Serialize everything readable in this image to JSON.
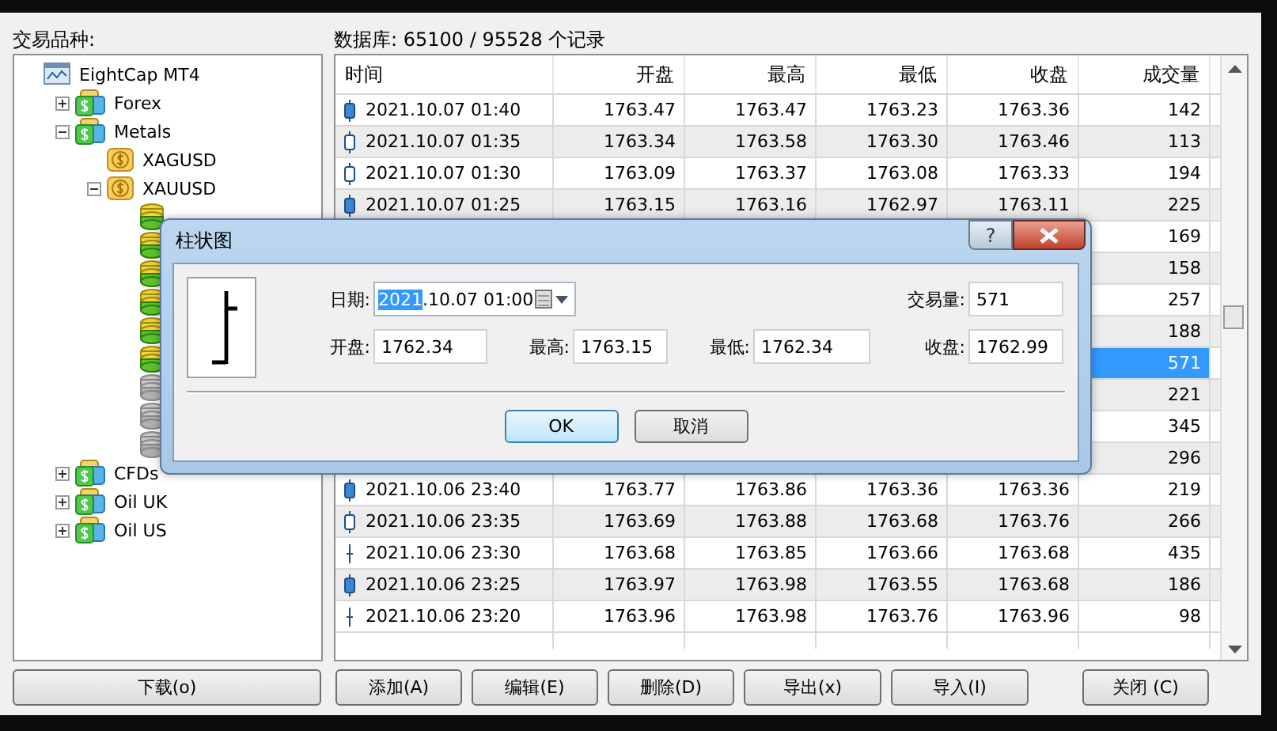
{
  "symbols_label": "交易品种:",
  "tree": [
    {
      "label": "EightCap MT4",
      "kind": "server",
      "children": [
        {
          "label": "Forex",
          "kind": "group",
          "expanded": false
        },
        {
          "label": "Metals",
          "kind": "group",
          "expanded": true,
          "children": [
            {
              "label": "XAGUSD",
              "kind": "symbol"
            },
            {
              "label": "XAUUSD",
              "kind": "symbol",
              "expanded": true,
              "children": [
                {
                  "kind": "period",
                  "available": true
                },
                {
                  "kind": "period",
                  "available": true
                },
                {
                  "kind": "period",
                  "available": true
                },
                {
                  "kind": "period",
                  "available": true
                },
                {
                  "kind": "period",
                  "available": true
                },
                {
                  "kind": "period",
                  "available": true
                },
                {
                  "kind": "period",
                  "available": false
                },
                {
                  "kind": "period",
                  "available": false
                },
                {
                  "kind": "period",
                  "available": false
                }
              ]
            }
          ]
        },
        {
          "label": "CFDs",
          "kind": "group",
          "expanded": false
        },
        {
          "label": "Oil UK",
          "kind": "group",
          "expanded": false
        },
        {
          "label": "Oil US",
          "kind": "group",
          "expanded": false
        }
      ]
    }
  ],
  "db_label": "数据库: 65100 / 95528 个记录",
  "table": {
    "columns": [
      "时间",
      "开盘",
      "最高",
      "最低",
      "收盘",
      "成交量"
    ],
    "rows": [
      {
        "kind": "filled",
        "cells": [
          "2021.10.07 01:40",
          "1763.47",
          "1763.47",
          "1763.23",
          "1763.36",
          "142"
        ],
        "selected": false
      },
      {
        "kind": "hollow",
        "cells": [
          "2021.10.07 01:35",
          "1763.34",
          "1763.58",
          "1763.30",
          "1763.46",
          "113"
        ],
        "selected": false
      },
      {
        "kind": "hollow",
        "cells": [
          "2021.10.07 01:30",
          "1763.09",
          "1763.37",
          "1763.08",
          "1763.33",
          "194"
        ],
        "selected": false
      },
      {
        "kind": "filled",
        "cells": [
          "2021.10.07 01:25",
          "1763.15",
          "1763.16",
          "1762.97",
          "1763.11",
          "225"
        ],
        "selected": false
      },
      {
        "cells": [
          "",
          "",
          "",
          "",
          "",
          "169"
        ],
        "selected": false
      },
      {
        "cells": [
          "",
          "",
          "",
          "",
          "",
          "158"
        ],
        "selected": false
      },
      {
        "cells": [
          "",
          "",
          "",
          "",
          "",
          "257"
        ],
        "selected": false
      },
      {
        "cells": [
          "",
          "",
          "",
          "",
          "",
          "188"
        ],
        "selected": false
      },
      {
        "cells": [
          "",
          "",
          "",
          "",
          "",
          "571"
        ],
        "selected": true
      },
      {
        "cells": [
          "",
          "",
          "",
          "",
          "",
          "221"
        ],
        "selected": false
      },
      {
        "cells": [
          "",
          "",
          "",
          "",
          "",
          "345"
        ],
        "selected": false
      },
      {
        "cells": [
          "",
          "",
          "",
          "",
          "",
          "296"
        ],
        "selected": false
      },
      {
        "kind": "filled",
        "cells": [
          "2021.10.06 23:40",
          "1763.77",
          "1763.86",
          "1763.36",
          "1763.36",
          "219"
        ],
        "selected": false
      },
      {
        "kind": "hollow",
        "cells": [
          "2021.10.06 23:35",
          "1763.69",
          "1763.88",
          "1763.68",
          "1763.76",
          "266"
        ],
        "selected": false
      },
      {
        "kind": "cross",
        "cells": [
          "2021.10.06 23:30",
          "1763.68",
          "1763.85",
          "1763.66",
          "1763.68",
          "435"
        ],
        "selected": false
      },
      {
        "kind": "filled",
        "cells": [
          "2021.10.06 23:25",
          "1763.97",
          "1763.98",
          "1763.55",
          "1763.68",
          "186"
        ],
        "selected": false
      },
      {
        "kind": "cross",
        "cells": [
          "2021.10.06 23:20",
          "1763.96",
          "1763.98",
          "1763.76",
          "1763.96",
          "98"
        ],
        "selected": false
      }
    ]
  },
  "buttons": [
    "下载(o)",
    "添加(A)",
    "编辑(E)",
    "删除(D)",
    "导出(x)",
    "导入(I)",
    "关闭 (C)"
  ],
  "dialog": {
    "title": "柱状图",
    "help": "?",
    "date_label": "日期:",
    "date_selected": "2021",
    "date_rest": ".10.07 01:00",
    "volume_label": "交易量:",
    "volume": "571",
    "fields": [
      {
        "label": "开盘:",
        "value": "1762.34"
      },
      {
        "label": "最高:",
        "value": "1763.15"
      },
      {
        "label": "最低:",
        "value": "1762.34"
      },
      {
        "label": "收盘:",
        "value": "1762.99"
      }
    ],
    "ok": "OK",
    "cancel": "取消"
  }
}
